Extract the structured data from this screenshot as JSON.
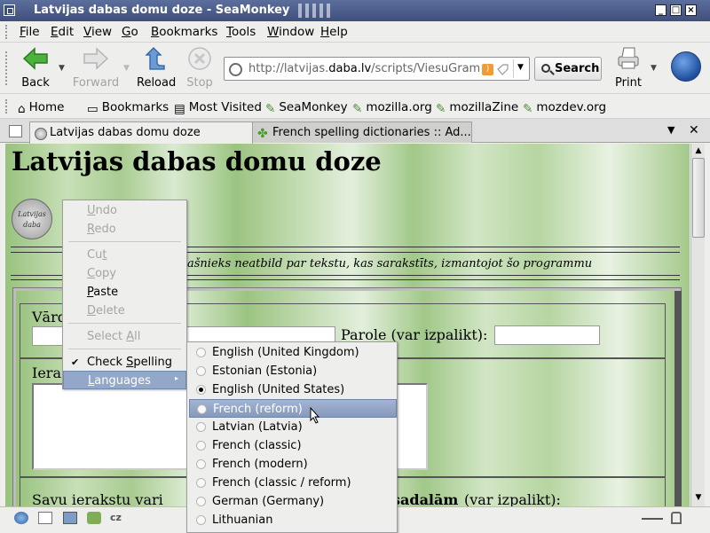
{
  "window": {
    "title": "Latvijas dabas domu doze - SeaMonkey",
    "buttons": {
      "minimize": "_",
      "maximize": "□",
      "close": "×"
    }
  },
  "menubar": {
    "items": [
      {
        "label": "File",
        "key": "F",
        "rest": "ile"
      },
      {
        "label": "Edit",
        "key": "E",
        "rest": "dit"
      },
      {
        "label": "View",
        "key": "V",
        "rest": "iew"
      },
      {
        "label": "Go",
        "key": "G",
        "rest": "o"
      },
      {
        "label": "Bookmarks",
        "key": "B",
        "rest": "ookmarks"
      },
      {
        "label": "Tools",
        "key": "T",
        "rest": "ools"
      },
      {
        "label": "Window",
        "key": "W",
        "rest": "indow"
      },
      {
        "label": "Help",
        "key": "H",
        "rest": "elp"
      }
    ]
  },
  "navbar": {
    "back": "Back",
    "forward": "Forward",
    "reload": "Reload",
    "stop": "Stop",
    "url_prefix": "http://latvijas.",
    "url_domain": "daba.lv",
    "url_rest": "/scripts/ViesuGramata",
    "search": "Search",
    "print": "Print"
  },
  "bookmarks": {
    "items": [
      "Home",
      "Bookmarks",
      "Most Visited",
      "SeaMonkey",
      "mozilla.org",
      "mozillaZine",
      "mozdev.org"
    ]
  },
  "tabs": [
    {
      "title": "Latvijas dabas domu doze",
      "selected": true
    },
    {
      "title": "French spelling dictionaries :: Ad...",
      "selected": false
    }
  ],
  "page": {
    "heading": "Latvijas dabas domu doze",
    "logo_text": "Latvijas daba",
    "disclaimer": "ašnieks neatbild par tekstu, kas sarakstīts, izmantojot šo programmu",
    "name_label": "Vārd",
    "password_label": "Parole (var izpalikt):",
    "entry_label": "Iera",
    "options_label_start": "Savu ierakstu vari",
    "options_label_bold": "sadalām",
    "options_label_end": "(var izpalikt):"
  },
  "context_menu": {
    "undo": {
      "key": "U",
      "rest": "ndo"
    },
    "redo": {
      "key": "R",
      "rest": "edo"
    },
    "cut": {
      "start": "Cu",
      "key": "t"
    },
    "copy": {
      "key": "C",
      "rest": "opy"
    },
    "paste": {
      "key": "P",
      "rest": "aste"
    },
    "delete": {
      "key": "D",
      "rest": "elete"
    },
    "select_all": {
      "start": "Select ",
      "key": "A",
      "rest": "ll"
    },
    "check_spelling": {
      "start": "Check ",
      "key": "S",
      "rest": "pelling"
    },
    "languages": {
      "key": "L",
      "rest": "anguages"
    },
    "check_mark": "✔",
    "submenu_arrow": "▸"
  },
  "languages": {
    "selected": "English (United States)",
    "highlighted": "French (reform)",
    "items": [
      "English (United Kingdom)",
      "Estonian (Estonia)",
      "English (United States)",
      "French (reform)",
      "Latvian (Latvia)",
      "French (classic)",
      "French (modern)",
      "French (classic / reform)",
      "German (Germany)",
      "Lithuanian"
    ]
  },
  "colors": {
    "titlebar": "#3e4f7c",
    "highlight": "#93a8c8",
    "page_green": "#a9cc91"
  },
  "icons": [
    "window-menu-icon",
    "back-arrow-icon",
    "forward-arrow-icon",
    "reload-icon",
    "stop-icon",
    "globe-icon",
    "rss-icon",
    "search-icon",
    "print-icon",
    "seamonkey-logo-icon",
    "home-icon",
    "folder-icon",
    "bookmark-icon",
    "tab-favicon-icon",
    "addon-icon",
    "radio-icon",
    "checkmark-icon"
  ]
}
